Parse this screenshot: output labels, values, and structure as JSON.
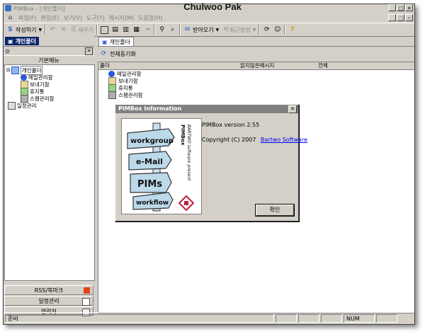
{
  "overlay": {
    "author": "Chulwoo Pak"
  },
  "window": {
    "title": "PIMBox - [개인폴더]"
  },
  "menu": [
    "파일(F)",
    "편집(E)",
    "보기(V)",
    "도구(T)",
    "메시지(M)",
    "도움말(H)"
  ],
  "toolbar": {
    "compose": "작성하기",
    "forward": "세우기",
    "receive": "받아오기",
    "history": "최근방법"
  },
  "left": {
    "header": "개인폴더",
    "basic_menu": "기본메뉴",
    "tree": [
      {
        "label": "개인폴더",
        "level": 0
      },
      {
        "label": "메일관리함",
        "level": 1
      },
      {
        "label": "보내기함",
        "level": 1
      },
      {
        "label": "휴지통",
        "level": 1
      },
      {
        "label": "스팸관리함",
        "level": 1
      },
      {
        "label": "일정관리",
        "level": 0
      }
    ],
    "bottom": [
      "RSS/북마크",
      "일정관리",
      "연락처"
    ]
  },
  "right": {
    "tab": "개인폴더",
    "refresh": "전체동기화",
    "columns": [
      "폴더",
      "읽지않은메시지",
      "전체"
    ],
    "items": [
      "메일관리함",
      "보내기함",
      "휴지통",
      "스팸관리함"
    ]
  },
  "dialog": {
    "title": "PIMBox Information",
    "version": "PIMBox version 2.55",
    "copyright": "Copyright (C) 2007",
    "company": "Bartwo Software",
    "ok": "확인",
    "logo_words": [
      "workgroup",
      "e-Mail",
      "PIMs",
      "workflow"
    ],
    "logo_caption": [
      "PIMBox",
      "BARTWO software present"
    ]
  },
  "status": {
    "ready": "준비",
    "num": "NUM"
  }
}
